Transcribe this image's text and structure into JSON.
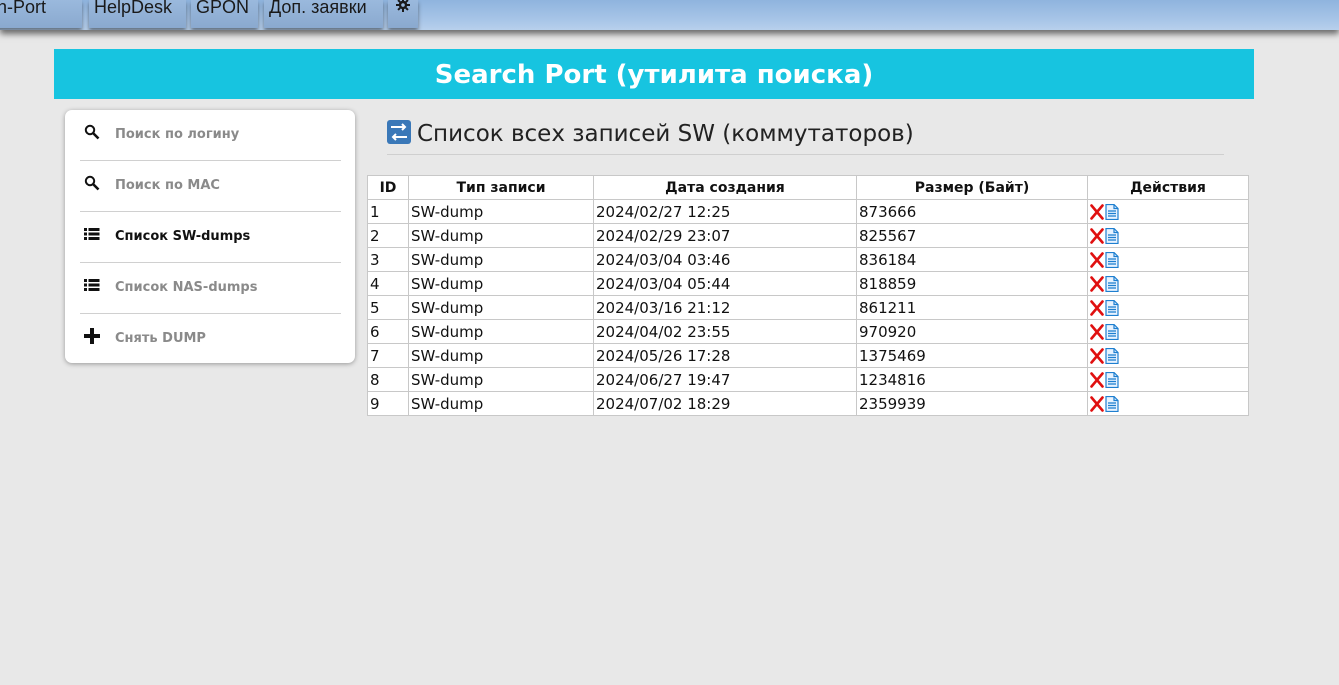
{
  "nav": {
    "tabs": [
      "arch-Port",
      "HelpDesk",
      "GPON",
      "Доп. заявки"
    ],
    "gear_icon": "gear-icon"
  },
  "banner": {
    "title": "Search Port (утилита поиска)"
  },
  "sidebar": {
    "items": [
      {
        "label": "Поиск по логину",
        "icon": "search-icon",
        "active": false
      },
      {
        "label": "Поиск по MAC",
        "icon": "search-icon",
        "active": false
      },
      {
        "label": "Список SW-dumps",
        "icon": "list-icon",
        "active": true
      },
      {
        "label": "Список NAS-dumps",
        "icon": "list-icon",
        "active": false
      },
      {
        "label": "Снять DUMP",
        "icon": "plus-icon",
        "active": false
      }
    ]
  },
  "content": {
    "title": "Список всех записей SW (коммутаторов)",
    "table": {
      "headers": [
        "ID",
        "Тип записи",
        "Дата создания",
        "Размер (Байт)",
        "Действия"
      ],
      "rows": [
        [
          "1",
          "SW-dump",
          "2024/02/27 12:25",
          "873666"
        ],
        [
          "2",
          "SW-dump",
          "2024/02/29 23:07",
          "825567"
        ],
        [
          "3",
          "SW-dump",
          "2024/03/04 03:46",
          "836184"
        ],
        [
          "4",
          "SW-dump",
          "2024/03/04 05:44",
          "818859"
        ],
        [
          "5",
          "SW-dump",
          "2024/03/16 21:12",
          "861211"
        ],
        [
          "6",
          "SW-dump",
          "2024/04/02 23:55",
          "970920"
        ],
        [
          "7",
          "SW-dump",
          "2024/05/26 17:28",
          "1375469"
        ],
        [
          "8",
          "SW-dump",
          "2024/06/27 19:47",
          "1234816"
        ],
        [
          "9",
          "SW-dump",
          "2024/07/02 18:29",
          "2359939"
        ]
      ],
      "row_actions": [
        "delete-icon",
        "document-icon"
      ]
    }
  },
  "colors": {
    "banner": "#17c4e0",
    "nav": "#9ab9dd",
    "delete": "#e01010",
    "document": "#1e7fd0"
  }
}
